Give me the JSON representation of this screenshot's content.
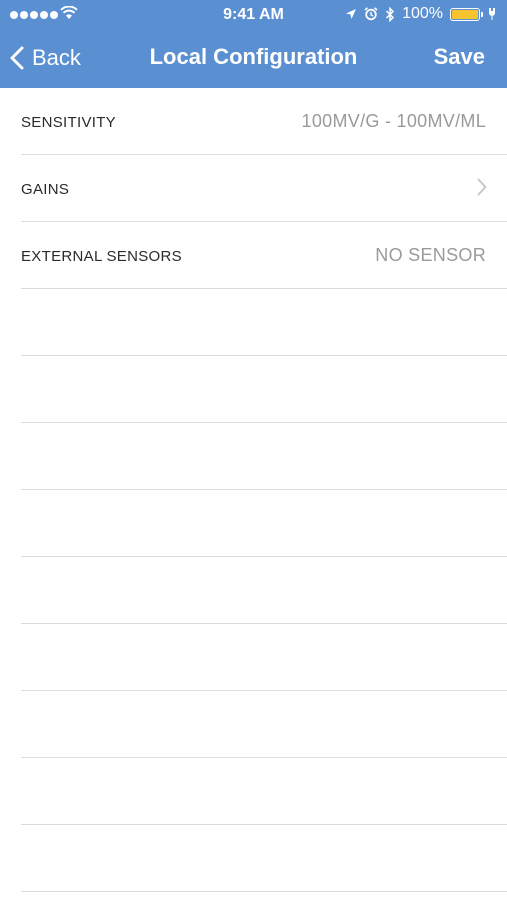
{
  "colors": {
    "accent": "#5a8fd2",
    "battery": "#f7c32e"
  },
  "status_bar": {
    "time": "9:41 AM",
    "battery_pct": "100%",
    "signal_bars": 5,
    "icons": [
      "wifi-icon",
      "location-arrow-icon",
      "alarm-icon",
      "bluetooth-icon",
      "battery-icon"
    ]
  },
  "nav": {
    "back_label": "Back",
    "title": "Local Configuration",
    "save_label": "Save"
  },
  "settings": [
    {
      "label": "SENSITIVITY",
      "value": "100MV/G - 100MV/ML"
    },
    {
      "label": "GAINS",
      "value": "",
      "icon": "chevron-right-icon"
    },
    {
      "label": "EXTERNAL SENSORS",
      "value": "NO SENSOR"
    }
  ],
  "empty_rows": 9
}
